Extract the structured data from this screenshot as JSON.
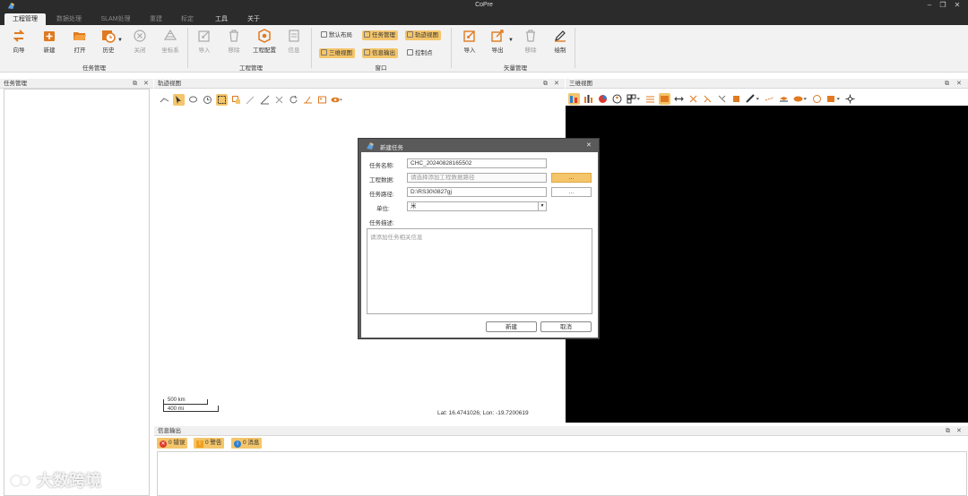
{
  "app": {
    "title": "CoPre"
  },
  "menu": {
    "tabs": [
      "工程管理",
      "数据处理",
      "SLAM处理",
      "重建",
      "标定",
      "工具",
      "关于"
    ]
  },
  "ribbon": {
    "task_group": {
      "label": "任务管理",
      "buttons": [
        "向导",
        "新建",
        "打开",
        "历史",
        "关闭",
        "坐标系"
      ]
    },
    "project_group": {
      "label": "工程管理",
      "buttons": [
        "导入",
        "移除",
        "工程配置",
        "信息"
      ]
    },
    "window_group": {
      "label": "窗口",
      "chips": [
        "默认布局",
        "任务管理",
        "轨迹视图",
        "三维视图",
        "信息输出",
        "控制点"
      ]
    },
    "vector_group": {
      "label": "矢量管理",
      "buttons": [
        "导入",
        "导出",
        "移除",
        "绘制"
      ]
    }
  },
  "panels": {
    "task_manager": "任务管理",
    "trajectory_view": "轨迹视图",
    "view_3d": "三维视图",
    "info_output": "信息输出"
  },
  "map": {
    "scale_km": "500 km",
    "scale_mi": "400 mi",
    "coords": "Lat: 16.4741026; Lon: -19.7200619"
  },
  "dialog": {
    "title": "新建任务",
    "name_label": "任务名称:",
    "name_value": "CHC_20240828165502",
    "project_label": "工程数据:",
    "project_placeholder": "请选择添加工程数据路径",
    "path_label": "任务路径:",
    "path_value": "D:\\RS30\\0827gj",
    "unit_label": "单位:",
    "unit_value": "米",
    "desc_label": "任务描述:",
    "desc_placeholder": "请添加任务相关信息",
    "browse": "...",
    "ok": "新建",
    "cancel": "取消"
  },
  "status": {
    "errors": "0 错误",
    "warnings": "0 警告",
    "messages": "0 消息"
  },
  "watermark": "大数跨境",
  "colors": {
    "accent": "#f4c56a",
    "dark": "#2b2b2b",
    "error": "#e03a2e",
    "warn": "#f0a020",
    "info": "#2d7fd3"
  }
}
